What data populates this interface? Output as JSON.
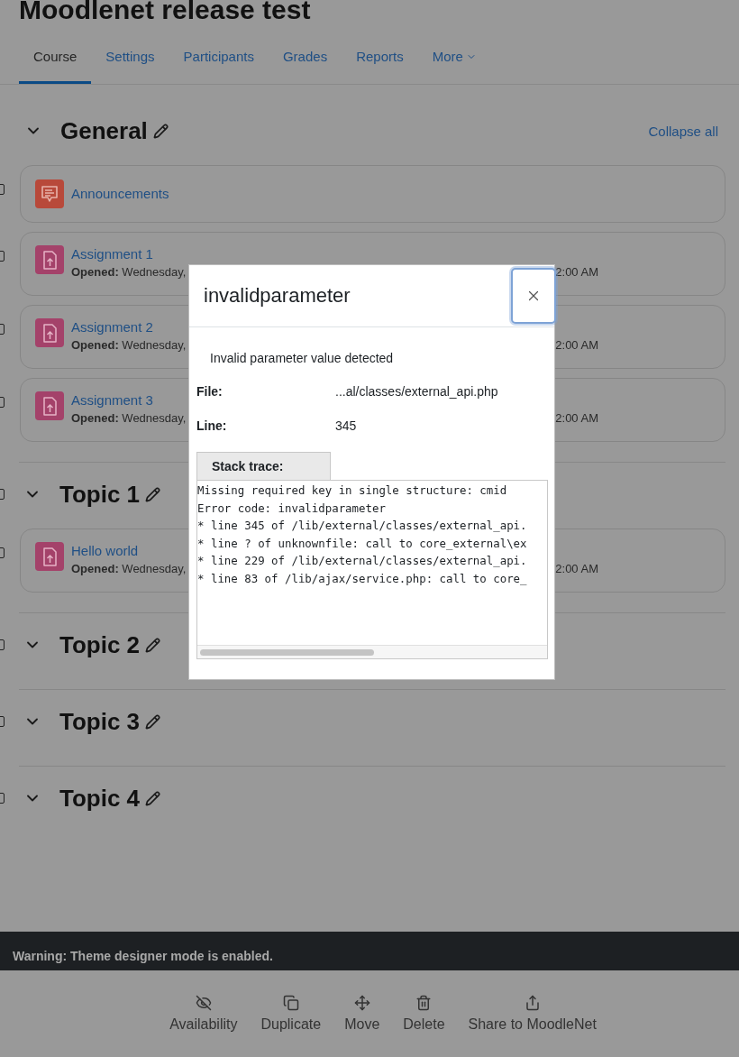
{
  "course_title": "Moodlenet release test",
  "tabs": [
    {
      "label": "Course",
      "selected": true,
      "kind": "link"
    },
    {
      "label": "Settings",
      "selected": false,
      "kind": "link"
    },
    {
      "label": "Participants",
      "selected": false,
      "kind": "link"
    },
    {
      "label": "Grades",
      "selected": false,
      "kind": "link"
    },
    {
      "label": "Reports",
      "selected": false,
      "kind": "link"
    },
    {
      "label": "More",
      "selected": false,
      "kind": "menu"
    }
  ],
  "collapse_all": "Collapse all",
  "sections": [
    {
      "title": "General",
      "expanded": true,
      "activities": [
        {
          "kind": "forum",
          "name": "Announcements",
          "checked": false
        },
        {
          "kind": "assignment",
          "name": "Assignment 1",
          "checked": false,
          "date_label": "Opened:",
          "date_start": "Wednesday,",
          "date_end": "2:00 AM"
        },
        {
          "kind": "assignment",
          "name": "Assignment 2",
          "checked": false,
          "date_label": "Opened:",
          "date_start": "Wednesday,",
          "date_end": "2:00 AM"
        },
        {
          "kind": "assignment",
          "name": "Assignment 3",
          "checked": false,
          "date_label": "Opened:",
          "date_start": "Wednesday,",
          "date_end": "2:00 AM"
        }
      ]
    },
    {
      "title": "Topic 1",
      "expanded": true,
      "checked": false,
      "activities": [
        {
          "kind": "assignment",
          "name": "Hello world",
          "checked": false,
          "date_label": "Opened:",
          "date_start": "Wednesday,",
          "date_end": "2:00 AM"
        }
      ]
    },
    {
      "title": "Topic 2",
      "expanded": true,
      "checked": false
    },
    {
      "title": "Topic 3",
      "expanded": true,
      "checked": false
    },
    {
      "title": "Topic 4",
      "expanded": true,
      "checked": false
    }
  ],
  "modal": {
    "title": "invalidparameter",
    "message": "Invalid parameter value detected",
    "fields": [
      {
        "label": "File:",
        "value": "...al/classes/external_api.php"
      },
      {
        "label": "Line:",
        "value": "345"
      }
    ],
    "stack_trace_label": "Stack trace:",
    "stack_trace": [
      "Missing required key in single structure: cmid",
      "Error code: invalidparameter",
      "* line 345 of /lib/external/classes/external_api.",
      "* line ? of unknownfile: call to core_external\\ex",
      "* line 229 of /lib/external/classes/external_api.",
      "* line 83 of /lib/ajax/service.php: call to core_"
    ]
  },
  "warning": "Warning: Theme designer mode is enabled.",
  "actions": [
    {
      "kind": "availability",
      "label": "Availability"
    },
    {
      "kind": "duplicate",
      "label": "Duplicate"
    },
    {
      "kind": "move",
      "label": "Move"
    },
    {
      "kind": "delete",
      "label": "Delete"
    },
    {
      "kind": "share",
      "label": "Share to MoodleNet"
    }
  ]
}
